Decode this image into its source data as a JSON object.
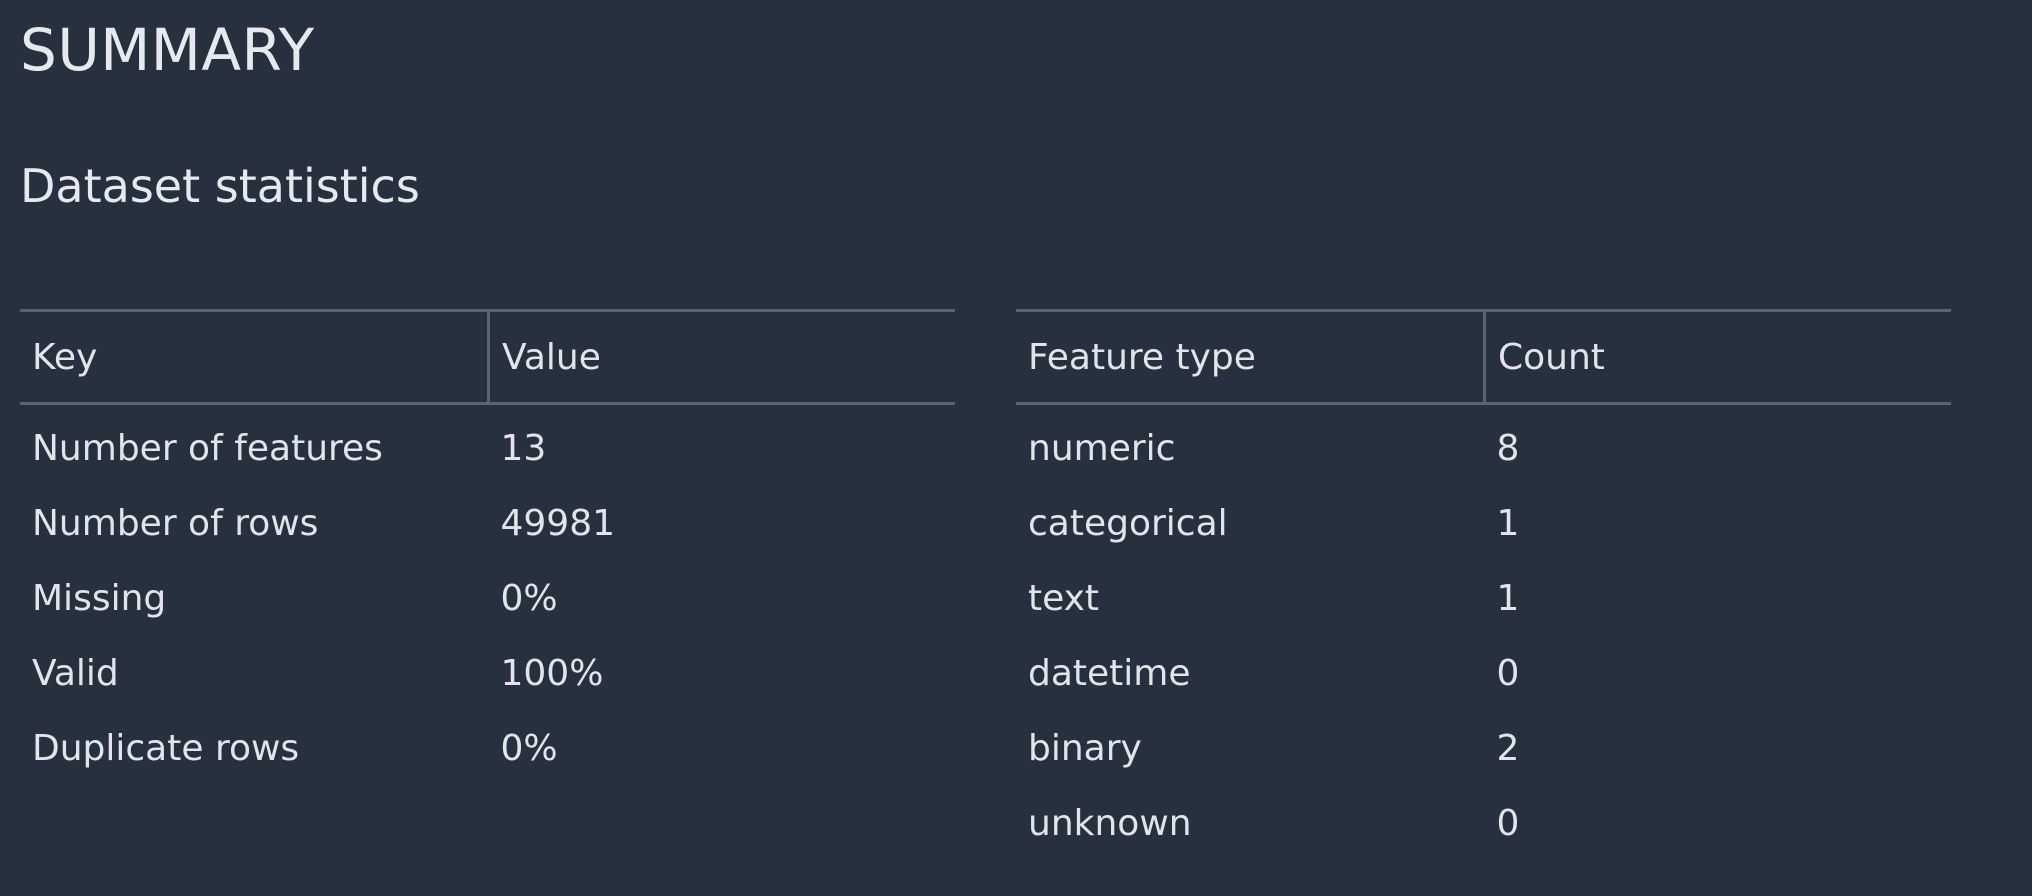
{
  "page": {
    "title": "SUMMARY",
    "section_title": "Dataset statistics"
  },
  "stats_table": {
    "headers": [
      "Key",
      "Value"
    ],
    "rows": [
      [
        "Number of features",
        "13"
      ],
      [
        "Number of rows",
        "49981"
      ],
      [
        "Missing",
        "0%"
      ],
      [
        "Valid",
        "100%"
      ],
      [
        "Duplicate rows",
        "0%"
      ]
    ]
  },
  "feature_table": {
    "headers": [
      "Feature type",
      "Count"
    ],
    "rows": [
      [
        "numeric",
        "8"
      ],
      [
        "categorical",
        "1"
      ],
      [
        "text",
        "1"
      ],
      [
        "datetime",
        "0"
      ],
      [
        "binary",
        "2"
      ],
      [
        "unknown",
        "0"
      ]
    ]
  },
  "colors": {
    "background": "#27303e",
    "text": "#e1e4e9",
    "border": "#5b6370"
  }
}
